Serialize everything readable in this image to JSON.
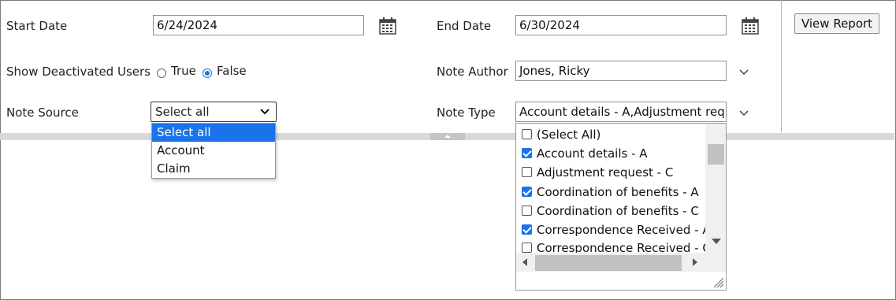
{
  "filters": {
    "start_date": {
      "label": "Start Date",
      "value": "6/24/2024"
    },
    "end_date": {
      "label": "End Date",
      "value": "6/30/2024"
    },
    "show_deactivated": {
      "label": "Show Deactivated Users",
      "true_label": "True",
      "false_label": "False",
      "selected": "False"
    },
    "note_author": {
      "label": "Note Author",
      "value": "Jones, Ricky"
    },
    "note_source": {
      "label": "Note Source",
      "value": "Select all",
      "options": [
        "Select all",
        "Account",
        "Claim"
      ],
      "highlighted": "Select all"
    },
    "note_type": {
      "label": "Note Type",
      "value": "Account details - A,Adjustment req",
      "items": [
        {
          "label": "(Select All)",
          "checked": false
        },
        {
          "label": "Account details - A",
          "checked": true
        },
        {
          "label": "Adjustment request - C",
          "checked": false
        },
        {
          "label": "Coordination of benefits - A",
          "checked": true
        },
        {
          "label": "Coordination of benefits - C",
          "checked": false
        },
        {
          "label": "Correspondence Received - A",
          "checked": true
        },
        {
          "label": "Correspondence Received - C",
          "checked": false
        }
      ]
    }
  },
  "toolbar": {
    "view_report_label": "View Report"
  },
  "icons": {
    "calendar": "calendar-icon",
    "chevron": "chevron-down-icon",
    "splitter_toggle": "collapse-arrow-icon"
  },
  "colors": {
    "accent": "#1a73e8",
    "splitter": "#d9d9d9"
  }
}
